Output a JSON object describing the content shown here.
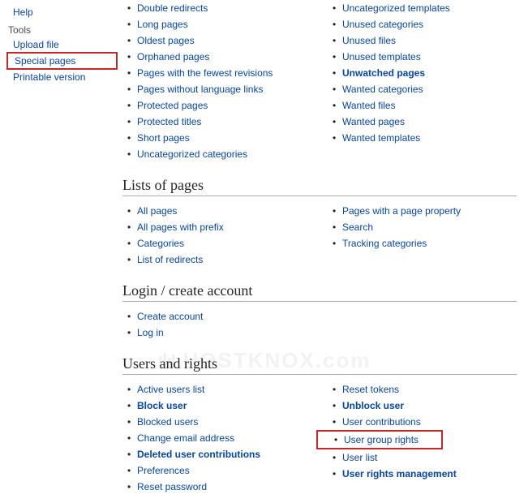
{
  "sidebar": {
    "help": "Help",
    "tools_heading": "Tools",
    "upload_file": "Upload file",
    "special_pages": "Special pages",
    "printable_version": "Printable version"
  },
  "sections": {
    "section0": {
      "left": [
        {
          "label": "Double redirects",
          "bold": false
        },
        {
          "label": "Long pages",
          "bold": false
        },
        {
          "label": "Oldest pages",
          "bold": false
        },
        {
          "label": "Orphaned pages",
          "bold": false
        },
        {
          "label": "Pages with the fewest revisions",
          "bold": false
        },
        {
          "label": "Pages without language links",
          "bold": false
        },
        {
          "label": "Protected pages",
          "bold": false
        },
        {
          "label": "Protected titles",
          "bold": false
        },
        {
          "label": "Short pages",
          "bold": false
        },
        {
          "label": "Uncategorized categories",
          "bold": false
        }
      ],
      "right": [
        {
          "label": "Uncategorized templates",
          "bold": false
        },
        {
          "label": "Unused categories",
          "bold": false
        },
        {
          "label": "Unused files",
          "bold": false
        },
        {
          "label": "Unused templates",
          "bold": false
        },
        {
          "label": "Unwatched pages",
          "bold": true
        },
        {
          "label": "Wanted categories",
          "bold": false
        },
        {
          "label": "Wanted files",
          "bold": false
        },
        {
          "label": "Wanted pages",
          "bold": false
        },
        {
          "label": "Wanted templates",
          "bold": false
        }
      ]
    },
    "section1": {
      "heading": "Lists of pages",
      "left": [
        {
          "label": "All pages",
          "bold": false
        },
        {
          "label": "All pages with prefix",
          "bold": false
        },
        {
          "label": "Categories",
          "bold": false
        },
        {
          "label": "List of redirects",
          "bold": false
        }
      ],
      "right": [
        {
          "label": "Pages with a page property",
          "bold": false
        },
        {
          "label": "Search",
          "bold": false
        },
        {
          "label": "Tracking categories",
          "bold": false
        }
      ]
    },
    "section2": {
      "heading": "Login / create account",
      "left": [
        {
          "label": "Create account",
          "bold": false
        },
        {
          "label": "Log in",
          "bold": false
        }
      ],
      "right": []
    },
    "section3": {
      "heading": "Users and rights",
      "left": [
        {
          "label": "Active users list",
          "bold": false
        },
        {
          "label": "Block user",
          "bold": true
        },
        {
          "label": "Blocked users",
          "bold": false
        },
        {
          "label": "Change email address",
          "bold": false
        },
        {
          "label": "Deleted user contributions",
          "bold": true
        },
        {
          "label": "Preferences",
          "bold": false
        },
        {
          "label": "Reset password",
          "bold": false
        }
      ],
      "right_a": [
        {
          "label": "Reset tokens",
          "bold": false
        },
        {
          "label": "Unblock user",
          "bold": true
        },
        {
          "label": "User contributions",
          "bold": false
        }
      ],
      "right_highlight": {
        "label": "User group rights",
        "bold": false
      },
      "right_b": [
        {
          "label": "User list",
          "bold": false
        },
        {
          "label": "User rights management",
          "bold": true
        }
      ]
    }
  },
  "watermark": "HOSTKNOX.com"
}
